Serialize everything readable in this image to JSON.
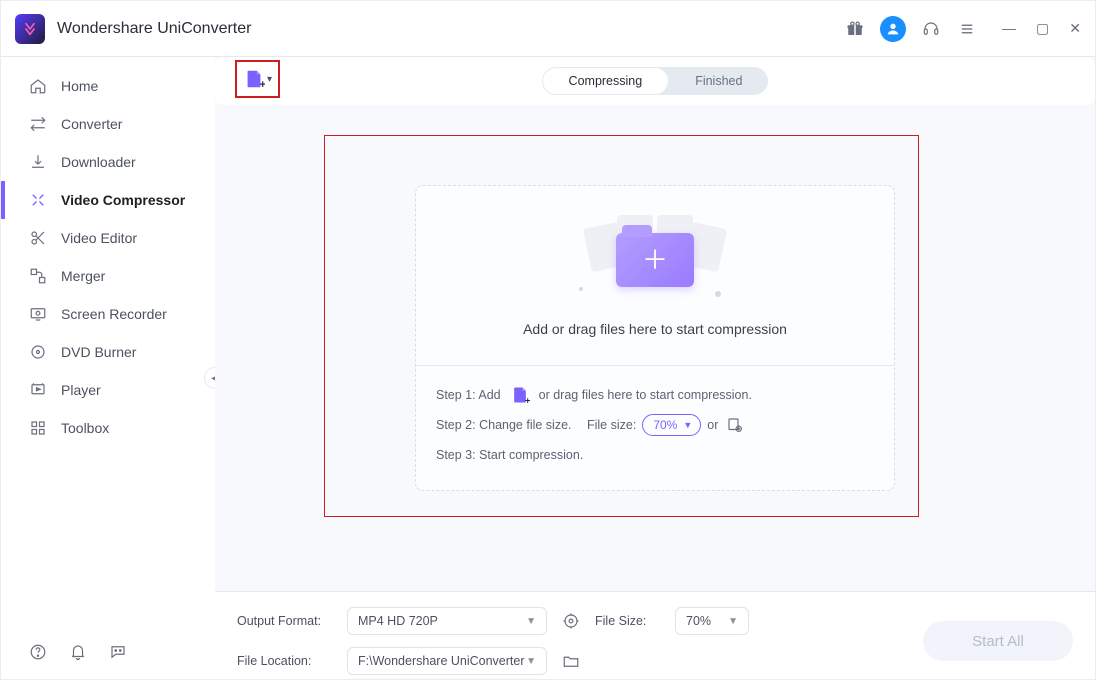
{
  "app": {
    "title": "Wondershare UniConverter"
  },
  "sidebar": {
    "items": [
      {
        "label": "Home"
      },
      {
        "label": "Converter"
      },
      {
        "label": "Downloader"
      },
      {
        "label": "Video Compressor"
      },
      {
        "label": "Video Editor"
      },
      {
        "label": "Merger"
      },
      {
        "label": "Screen Recorder"
      },
      {
        "label": "DVD Burner"
      },
      {
        "label": "Player"
      },
      {
        "label": "Toolbox"
      }
    ]
  },
  "tabs": {
    "compressing": "Compressing",
    "finished": "Finished"
  },
  "drop": {
    "text": "Add or drag files here to start compression"
  },
  "steps": {
    "s1a": "Step 1: Add",
    "s1b": "or drag files here to start compression.",
    "s2a": "Step 2: Change file size.",
    "s2b": "File size:",
    "s2_value": "70%",
    "s2_or": "or",
    "s3": "Step 3: Start compression."
  },
  "footer": {
    "output_format_label": "Output Format:",
    "output_format_value": "MP4 HD 720P",
    "file_size_label": "File Size:",
    "file_size_value": "70%",
    "file_location_label": "File Location:",
    "file_location_value": "F:\\Wondershare UniConverter",
    "start_button": "Start All"
  }
}
